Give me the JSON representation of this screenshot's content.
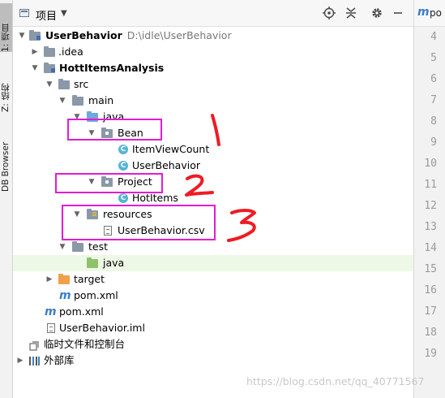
{
  "left_strip": {
    "tabs": [
      {
        "label": "1: 项目",
        "active": true
      },
      {
        "label": "Z: 结构",
        "active": false
      },
      {
        "label": "DB Browser",
        "active": false
      }
    ]
  },
  "panel": {
    "title": "项目",
    "buttons": [
      "locate-icon",
      "collapse-icon",
      "gear-icon",
      "minimize-icon"
    ]
  },
  "tree": {
    "rows": [
      {
        "name": "UserBehavior",
        "path": "D:\\idle\\UserBehavior"
      },
      {
        "name": ".idea"
      },
      {
        "name": "HottItemsAnalysis"
      },
      {
        "name": "src"
      },
      {
        "name": "main"
      },
      {
        "name": "java"
      },
      {
        "name": "Bean"
      },
      {
        "name": "ItemViewCount"
      },
      {
        "name": "UserBehavior"
      },
      {
        "name": "Project"
      },
      {
        "name": "HotItems"
      },
      {
        "name": "resources"
      },
      {
        "name": "UserBehavior.csv"
      },
      {
        "name": "test"
      },
      {
        "name": "java"
      },
      {
        "name": "target"
      },
      {
        "name": "pom.xml"
      },
      {
        "name": "pom.xml"
      },
      {
        "name": "UserBehavior.iml"
      },
      {
        "name": "临时文件和控制台"
      },
      {
        "name": "外部库"
      }
    ]
  },
  "annotations": {
    "numbers": [
      "1",
      "2",
      "3"
    ],
    "color": "#e51bd3",
    "number_color": "#ee1c24"
  },
  "editor": {
    "tab_title": "po",
    "tab_icon": "m",
    "line_numbers": [
      "4",
      "5",
      "6",
      "7",
      "8",
      "9",
      "10",
      "11",
      "12",
      "13",
      "14",
      "15",
      "16",
      "17",
      "18",
      "19"
    ]
  },
  "watermark": "https://blog.csdn.net/qq_40771567"
}
